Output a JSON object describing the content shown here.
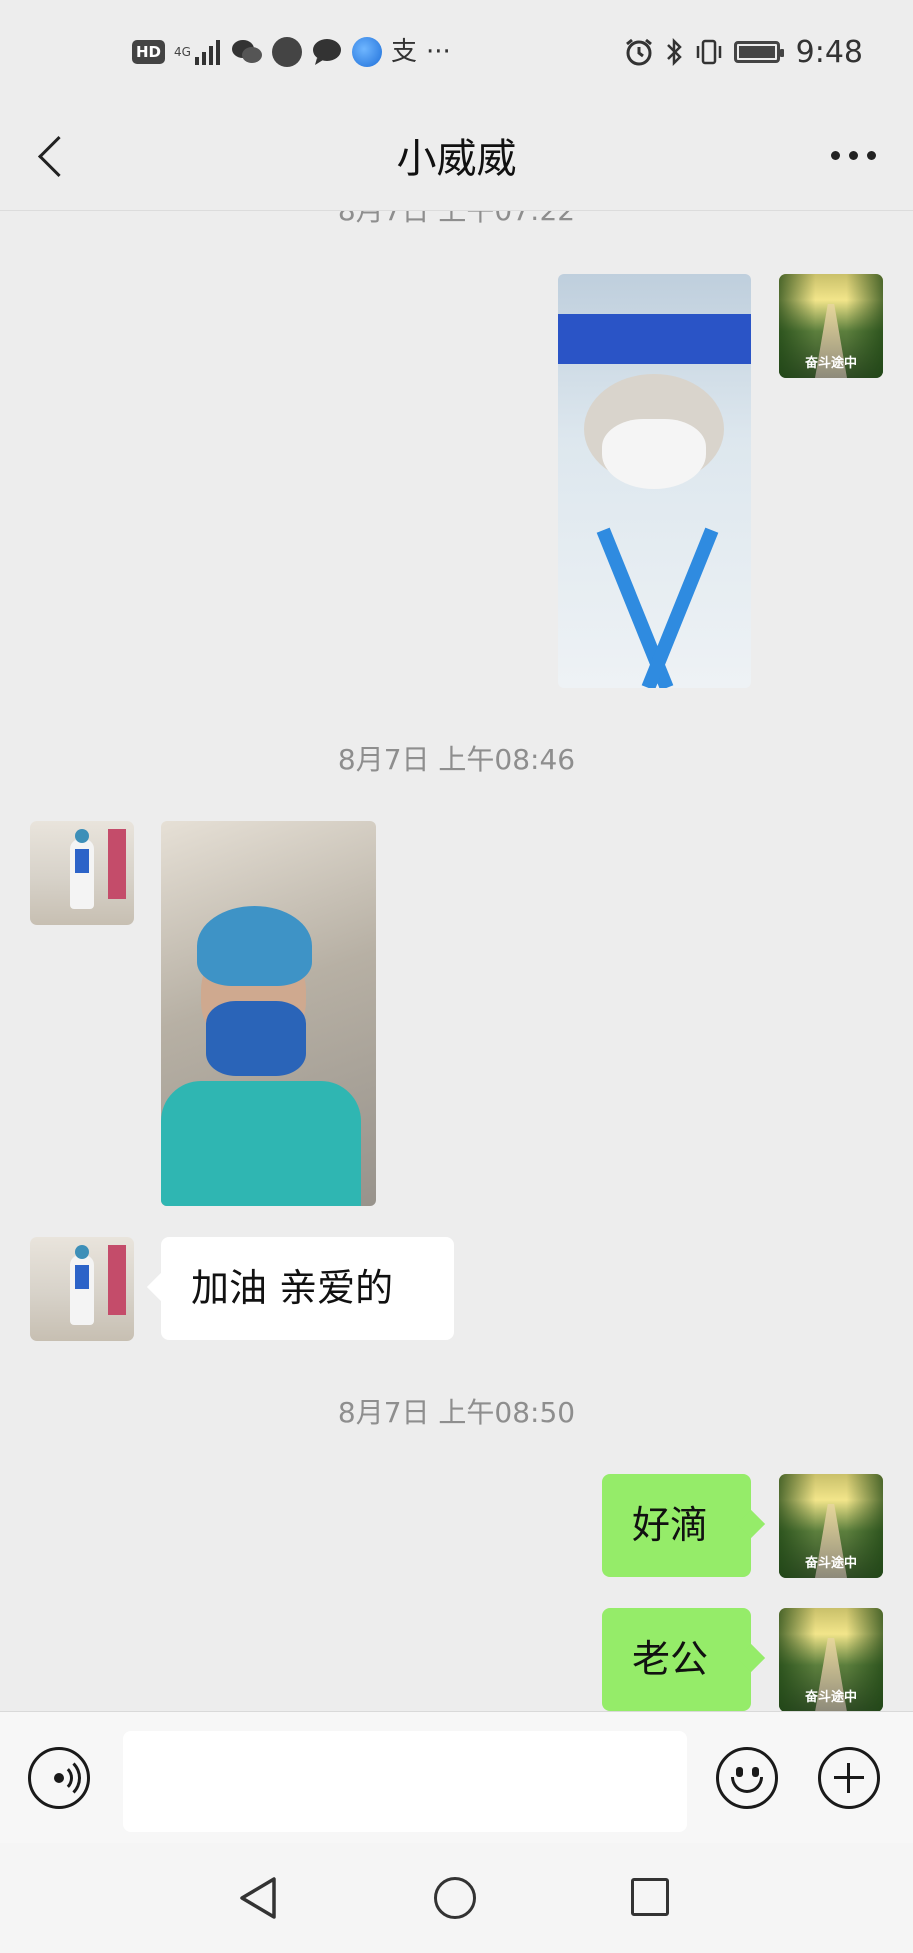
{
  "status_bar": {
    "time": "9:48",
    "hd_badge": "HD",
    "network": "4G",
    "alipay_char": "支",
    "more_indicator": "···",
    "icons": [
      "hd-icon",
      "signal-icon",
      "wechat-icon",
      "app-icon",
      "message-icon",
      "browser-icon",
      "alipay-icon",
      "alarm-icon",
      "bluetooth-icon",
      "vibrate-icon",
      "battery-icon"
    ],
    "battery_level": 0.9
  },
  "header": {
    "title": "小威威",
    "back_icon": "chevron-left-icon",
    "more_icon": "more-icon"
  },
  "chat": {
    "partial_timestamp": "8月7日 上午07:22",
    "messages": [
      {
        "from": "me",
        "kind": "image",
        "desc_icon": "photo"
      },
      {
        "kind": "timestamp",
        "text": "8月7日 上午08:46"
      },
      {
        "from": "contact",
        "kind": "image",
        "desc_icon": "photo"
      },
      {
        "from": "contact",
        "kind": "text",
        "text": "加油 亲爱的"
      },
      {
        "kind": "timestamp",
        "text": "8月7日 上午08:50"
      },
      {
        "from": "me",
        "kind": "text",
        "text": "好滴"
      },
      {
        "from": "me",
        "kind": "text",
        "text": "老公"
      }
    ],
    "my_avatar_caption": "奋斗途中"
  },
  "input_bar": {
    "value": "",
    "icons": [
      "voice-icon",
      "emoji-icon",
      "plus-icon"
    ]
  },
  "nav_bar": {
    "icons": [
      "nav-back-icon",
      "nav-home-icon",
      "nav-recent-icon"
    ]
  },
  "colors": {
    "background": "#ededed",
    "outgoing_bubble": "#95ec69",
    "incoming_bubble": "#ffffff",
    "timestamp": "#8e8e8e"
  }
}
